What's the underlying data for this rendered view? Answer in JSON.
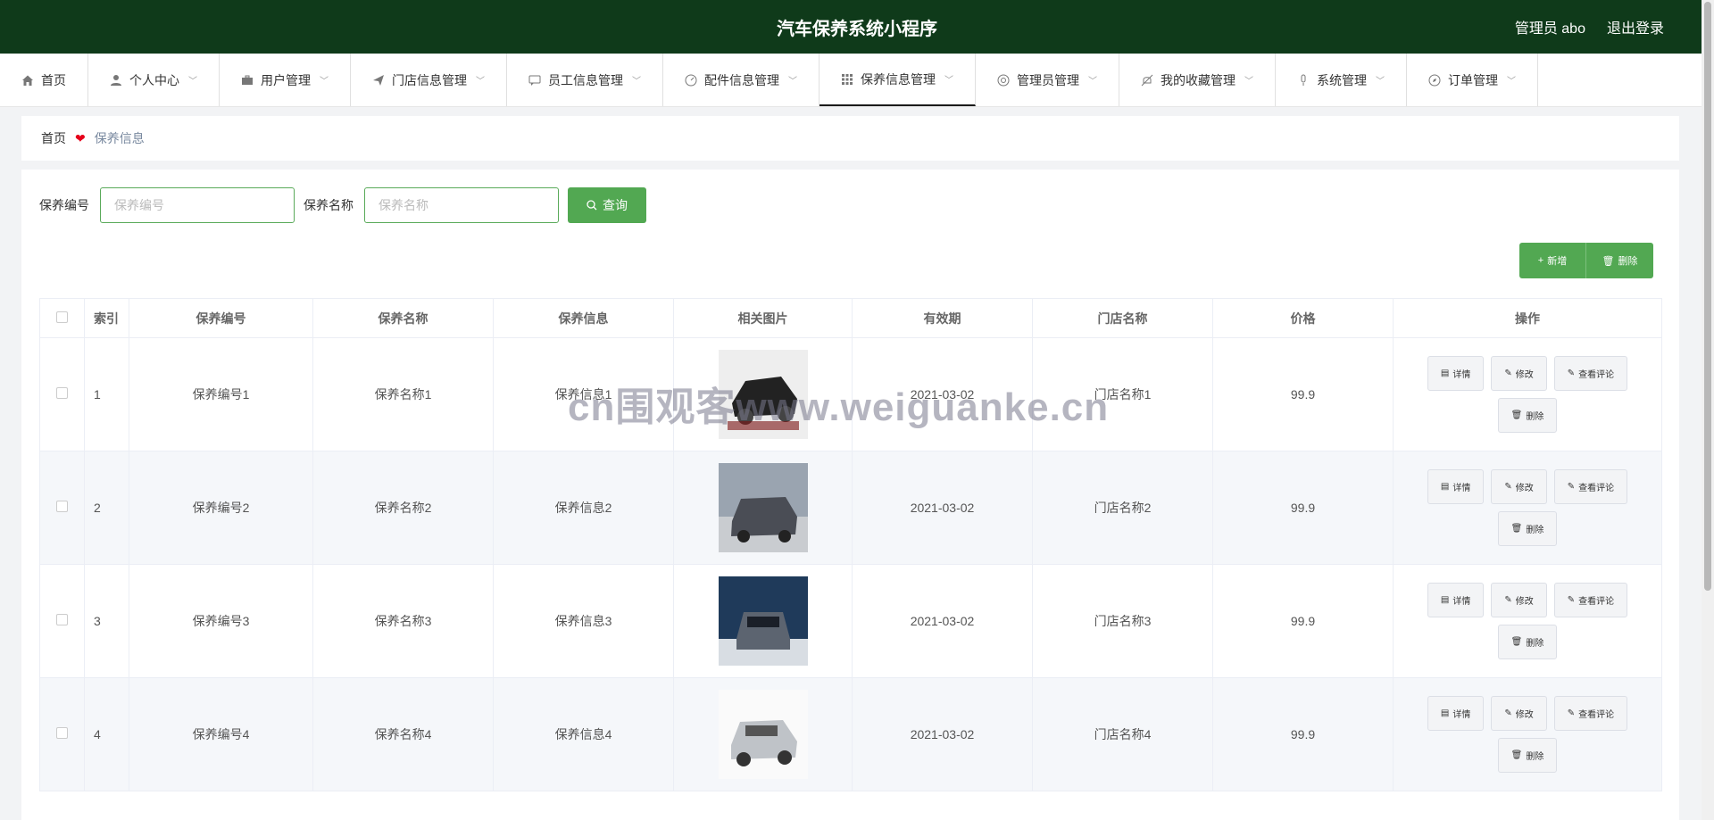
{
  "header": {
    "title": "汽车保养系统小程序",
    "admin": "管理员 abo",
    "logout": "退出登录"
  },
  "nav": [
    {
      "label": "首页",
      "icon": "home-icon"
    },
    {
      "label": "个人中心",
      "icon": "user-icon"
    },
    {
      "label": "用户管理",
      "icon": "briefcase-icon"
    },
    {
      "label": "门店信息管理",
      "icon": "send-icon"
    },
    {
      "label": "员工信息管理",
      "icon": "chat-icon"
    },
    {
      "label": "配件信息管理",
      "icon": "gauge-icon"
    },
    {
      "label": "保养信息管理",
      "icon": "grid-icon"
    },
    {
      "label": "管理员管理",
      "icon": "lifebuoy-icon"
    },
    {
      "label": "我的收藏管理",
      "icon": "bell-off-icon"
    },
    {
      "label": "系统管理",
      "icon": "mic-icon"
    },
    {
      "label": "订单管理",
      "icon": "compass-icon"
    }
  ],
  "breadcrumb": {
    "home": "首页",
    "current": "保养信息"
  },
  "search": {
    "code_label": "保养编号",
    "code_placeholder": "保养编号",
    "name_label": "保养名称",
    "name_placeholder": "保养名称",
    "query_label": "查询"
  },
  "toolbar": {
    "add_label": "新增",
    "delete_label": "删除"
  },
  "table": {
    "headers": [
      "索引",
      "保养编号",
      "保养名称",
      "保养信息",
      "相关图片",
      "有效期",
      "门店名称",
      "价格",
      "操作"
    ],
    "rows": [
      {
        "index": "1",
        "code": "保养编号1",
        "name": "保养名称1",
        "info": "保养信息1",
        "date": "2021-03-02",
        "store": "门店名称1",
        "price": "99.9"
      },
      {
        "index": "2",
        "code": "保养编号2",
        "name": "保养名称2",
        "info": "保养信息2",
        "date": "2021-03-02",
        "store": "门店名称2",
        "price": "99.9"
      },
      {
        "index": "3",
        "code": "保养编号3",
        "name": "保养名称3",
        "info": "保养信息3",
        "date": "2021-03-02",
        "store": "门店名称3",
        "price": "99.9"
      },
      {
        "index": "4",
        "code": "保养编号4",
        "name": "保养名称4",
        "info": "保养信息4",
        "date": "2021-03-02",
        "store": "门店名称4",
        "price": "99.9"
      }
    ],
    "ops": {
      "detail": "详情",
      "edit": "修改",
      "comments": "查看评论",
      "delete": "删除"
    }
  },
  "watermark": "cn围观客www.weiguanke.cn",
  "colors": {
    "header_bg": "#0f3a1a",
    "accent": "#52a852",
    "breadcrumb_heart": "#e6001a"
  }
}
